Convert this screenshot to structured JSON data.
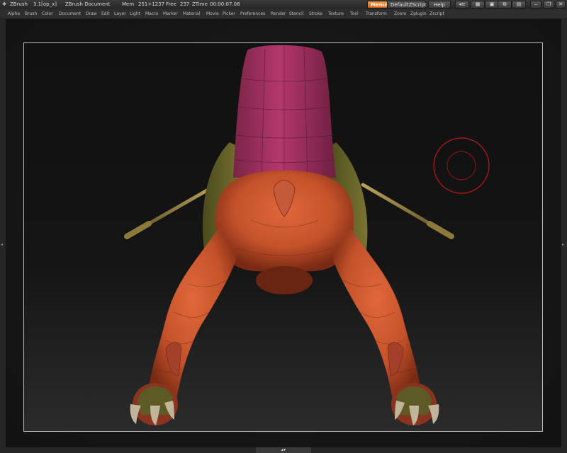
{
  "titlebar": {
    "app": "ZBrush",
    "version": "3.1[op_x]",
    "document": "ZBrush Document",
    "mem_label": "Mem",
    "mem_value": "251+1237",
    "free_label": "Free",
    "free_value": "237",
    "ztime_label": "ZTime",
    "ztime_value": "00:00:07.08",
    "menus_button": "Menus",
    "script_button": "DefaultZScript",
    "help_button": "Help"
  },
  "menubar": {
    "items": [
      "Alpha",
      "Brush",
      "Color",
      "Document",
      "Draw",
      "Edit",
      "Layer",
      "Light",
      "Macro",
      "Marker",
      "Material",
      "Movie",
      "Picker",
      "Preferences",
      "Render",
      "Stencil",
      "Stroke",
      "Texture",
      "Tool",
      "Transform",
      "Zoom",
      "Zplugin",
      "Zscript"
    ]
  },
  "colors": {
    "accent": "#e8741c",
    "body_orange": "#c8532a",
    "body_magenta": "#a8345f",
    "mask_olive": "#6b6a2a",
    "cursor_red": "#c01818"
  },
  "icons": {
    "window_controls": [
      "minimize-icon",
      "restore-icon",
      "close-icon"
    ]
  }
}
